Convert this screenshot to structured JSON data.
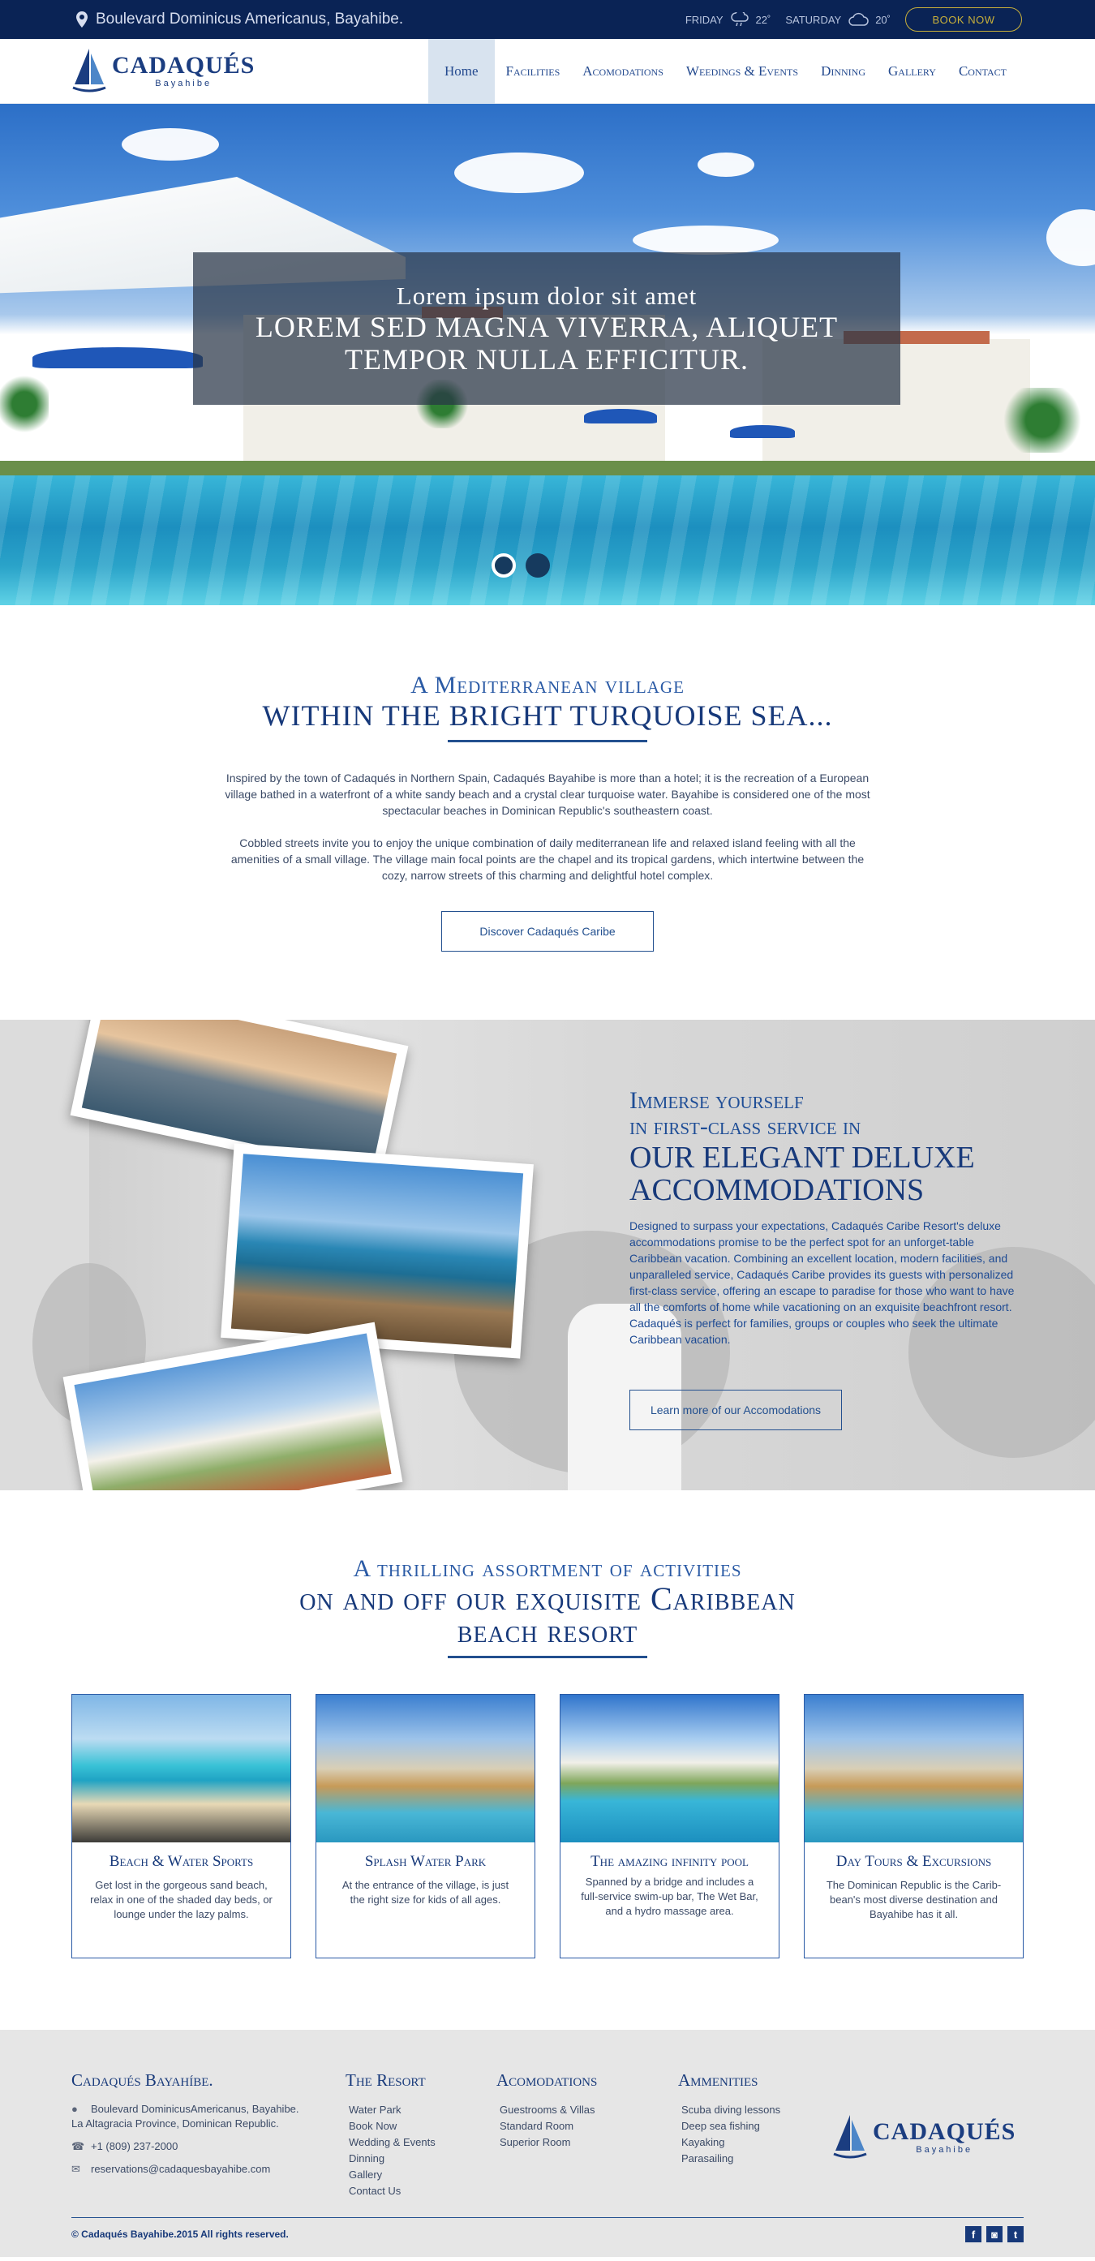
{
  "topbar": {
    "address": "Boulevard Dominicus Americanus, Bayahibe.",
    "weather": [
      {
        "day": "FRIDAY",
        "icon": "rain-cloud-icon",
        "temp": "22˚"
      },
      {
        "day": "SATURDAY",
        "icon": "cloudy-icon",
        "temp": "20˚"
      }
    ],
    "book_label": "BOOK NOW"
  },
  "logo": {
    "name": "CADAQUÉS",
    "sub": "Bayahibe"
  },
  "nav": {
    "items": [
      {
        "label": "Home",
        "active": true
      },
      {
        "label": "Facilities"
      },
      {
        "label": "Acomodations"
      },
      {
        "label": "Weedings & Events"
      },
      {
        "label": "Dinning"
      },
      {
        "label": "Gallery"
      },
      {
        "label": "Contact"
      }
    ]
  },
  "hero": {
    "line1": "Lorem ipsum dolor sit amet",
    "line2": "Lorem sed magna viverra, aliquet",
    "line3": "tempor nulla efficitur."
  },
  "intro": {
    "heading_small": "A Mediterranean village",
    "heading_large": "within the bright turquoise sea...",
    "p1": "Inspired by the town of Cadaqués in Northern Spain, Cadaqués Bayahibe is more than a hotel; it is the recreation of a European village bathed in a waterfront of a white sandy beach and a crystal clear turquoise water. Bayahibe is considered one of the most spectacular beaches in Dominican Republic's southeastern coast.",
    "p2": "Cobbled streets invite you to enjoy the unique combination of daily mediterranean life and relaxed island feeling with all the amenities of a small village. The village main focal points are the chapel and its tropical gardens, which intertwine between the cozy, narrow streets of this charming and delightful hotel complex.",
    "button": "Discover Cadaqués Caribe"
  },
  "immerse": {
    "line1": "Immerse yourself",
    "line2": "in first-class service in",
    "line3": "our elegant deluxe",
    "line4": "accommodations",
    "body": "Designed to surpass your expectations, Cadaqués Caribe Resort's deluxe accommodations promise to be the perfect spot for an unforget-table Caribbean vacation. Combining an excellent location, modern facilities, and unparalleled service, Cadaqués Caribe provides its guests with personalized first-class service, offering an escape to paradise for those who want to have all the comforts of home while vacationing on an exquisite beachfront resort. Cadaqués is perfect for families, groups or couples who seek the ultimate Caribbean vacation.",
    "button": "Learn more of our Accomodations"
  },
  "activities": {
    "heading_small": "A thrilling assortment of activities",
    "heading_large_1": "on and off our exquisite Caribbean",
    "heading_large_2": "beach resort",
    "cards": [
      {
        "title": "Beach & Water Sports",
        "desc": "Get lost in the gorgeous sand beach, relax in one of the shaded day beds, or lounge under the lazy palms."
      },
      {
        "title": "Splash Water Park",
        "desc": "At the entrance of the village, is just the right size for kids of all ages."
      },
      {
        "title": "The amazing infinity pool",
        "desc": "Spanned by a bridge and includes a full-service swim-up bar, The Wet Bar, and a hydro massage area."
      },
      {
        "title": "Day Tours & Excursions",
        "desc": "The Dominican Republic is the Carib-bean's most diverse destination and Bayahibe has it all."
      }
    ]
  },
  "footer": {
    "brand_title": "Cadaqués Bayahíbe.",
    "address_1": "Boulevard DominicusAmericanus, Bayahibe.",
    "address_2": "La Altagracia Province, Dominican Republic.",
    "phone": "+1 (809) 237-2000",
    "email": "reservations@cadaquesbayahibe.com",
    "resort": {
      "title": "The Resort",
      "items": [
        "Water Park",
        "Book Now",
        "Wedding & Events",
        "Dinning",
        "Gallery",
        "Contact Us"
      ]
    },
    "acomodations": {
      "title": "Acomodations",
      "items": [
        "Guestrooms & Villas",
        "Standard Room",
        "Superior Room"
      ]
    },
    "ammenities": {
      "title": "Ammenities",
      "items": [
        "Scuba diving lessons",
        "Deep sea fishing",
        "Kayaking",
        "Parasailing"
      ]
    },
    "copyright": "© Cadaqués Bayahibe.2015 All rights reserved.",
    "social": [
      "f",
      "◙",
      "t"
    ]
  },
  "colors": {
    "navy": "#0a2355",
    "brand_blue": "#17397a",
    "gold": "#c9b03a"
  }
}
